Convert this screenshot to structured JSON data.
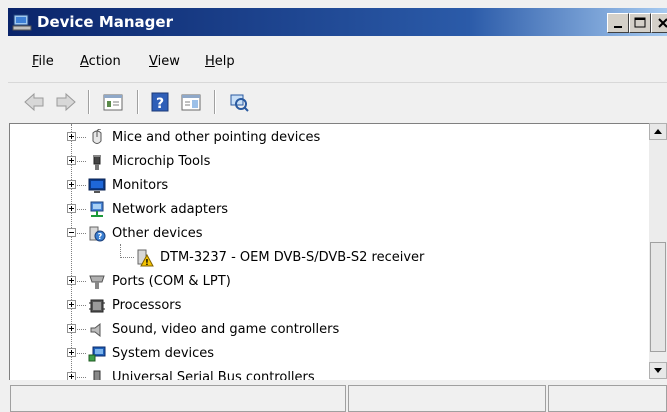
{
  "window": {
    "title": "Device Manager"
  },
  "menu": {
    "file": "File",
    "action": "Action",
    "view": "View",
    "help": "Help"
  },
  "toolbar": {
    "icons": [
      "back-icon",
      "forward-icon",
      "properties-icon",
      "help-icon",
      "show-hide-tree-icon",
      "scan-hardware-icon"
    ]
  },
  "tree": {
    "items": [
      {
        "label": "Mice and other pointing devices",
        "icon": "mouse-icon",
        "expanded": false
      },
      {
        "label": "Microchip Tools",
        "icon": "microchip-tools-icon",
        "expanded": false
      },
      {
        "label": "Monitors",
        "icon": "monitor-icon",
        "expanded": false
      },
      {
        "label": "Network adapters",
        "icon": "network-adapter-icon",
        "expanded": false
      },
      {
        "label": "Other devices",
        "icon": "other-devices-icon",
        "expanded": true
      },
      {
        "label": "DTM-3237 - OEM DVB-S/DVB-S2 receiver",
        "icon": "unknown-device-warning-icon",
        "child": true
      },
      {
        "label": "Ports (COM & LPT)",
        "icon": "port-icon",
        "expanded": false
      },
      {
        "label": "Processors",
        "icon": "processor-icon",
        "expanded": false
      },
      {
        "label": "Sound, video and game controllers",
        "icon": "speaker-icon",
        "expanded": false
      },
      {
        "label": "System devices",
        "icon": "system-devices-icon",
        "expanded": false
      },
      {
        "label": "Universal Serial Bus controllers",
        "icon": "usb-icon",
        "expanded": false
      }
    ]
  },
  "colors": {
    "titlebar_start": "#0a246a",
    "titlebar_end": "#a6caf0",
    "window_bg": "#f0f0f0",
    "warning": "#f5c400"
  }
}
